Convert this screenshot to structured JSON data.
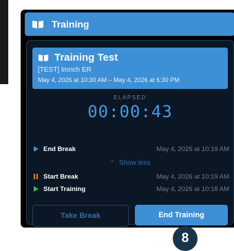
{
  "header": {
    "title": "Training",
    "icon": "book-open-icon"
  },
  "card": {
    "title": "Training Test",
    "icon": "book-open-icon",
    "subtitle": "[TEST] Imrich ER",
    "schedule": "May 4, 2026 at 10:30 AM – May 4, 2026 at 6:30 PM"
  },
  "timer": {
    "label": "ELAPSED",
    "value": "00:00:43"
  },
  "log": {
    "top": {
      "name": "End Break",
      "time": "May 4, 2026 at 10:19 AM",
      "icon": "play-icon",
      "color": "#3d8fd6"
    },
    "toggle": "Show less",
    "items": [
      {
        "name": "Start Break",
        "time": "May 4, 2026 at 10:19 AM",
        "icon": "pause-icon",
        "color": "#e6792b"
      },
      {
        "name": "Start Training",
        "time": "May 4, 2026 at 10:18 AM",
        "icon": "play-icon",
        "color": "#3cba5a"
      }
    ]
  },
  "actions": {
    "take_break": "Take Break",
    "end_training": "End Training"
  },
  "step_badge": "8",
  "colors": {
    "accent": "#3d8fd6",
    "panel": "#000000",
    "card": "#0b1724"
  }
}
